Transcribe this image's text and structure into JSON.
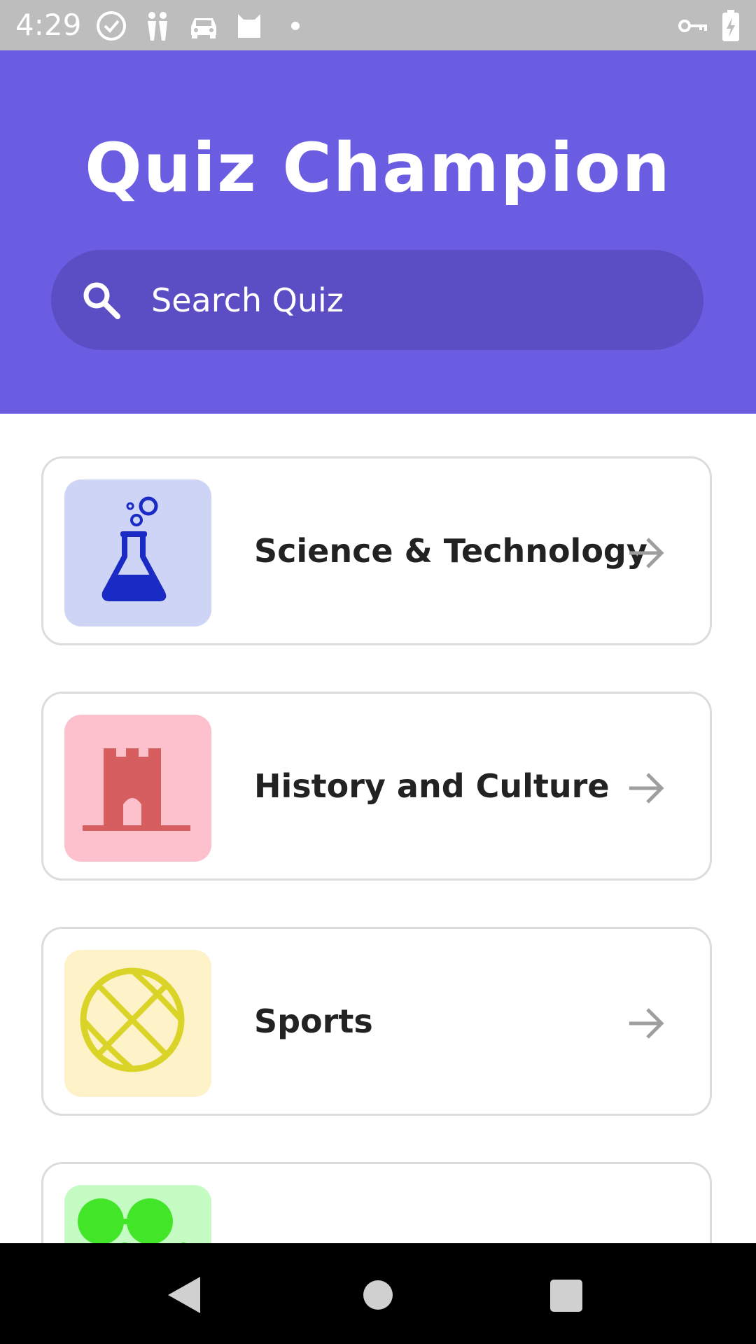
{
  "status_bar": {
    "time": "4:29",
    "left_icons": [
      "check-circle-icon",
      "people-icon",
      "car-icon",
      "cat-icon",
      "dot-icon"
    ],
    "right_icons": [
      "key-icon",
      "battery-charging-icon"
    ]
  },
  "header": {
    "title": "Quiz Champion",
    "background_color": "#6a5de2"
  },
  "search": {
    "placeholder": "Search Quiz",
    "value": ""
  },
  "categories": [
    {
      "label": "Science & Technology",
      "icon": "flask-icon",
      "thumb_color": "#cdd4f5",
      "icon_color": "#1a2ac4"
    },
    {
      "label": "History and Culture",
      "icon": "castle-icon",
      "thumb_color": "#fdc1cd",
      "icon_color": "#d65e5e"
    },
    {
      "label": "Sports",
      "icon": "basketball-icon",
      "thumb_color": "#fef2c8",
      "icon_color": "#dbd428"
    },
    {
      "label": "",
      "icon": "glasses-icon",
      "thumb_color": "#c4fcc4",
      "icon_color": "#42e528"
    }
  ],
  "nav_bar": {
    "buttons": [
      "back-icon",
      "home-icon",
      "recents-icon"
    ]
  }
}
